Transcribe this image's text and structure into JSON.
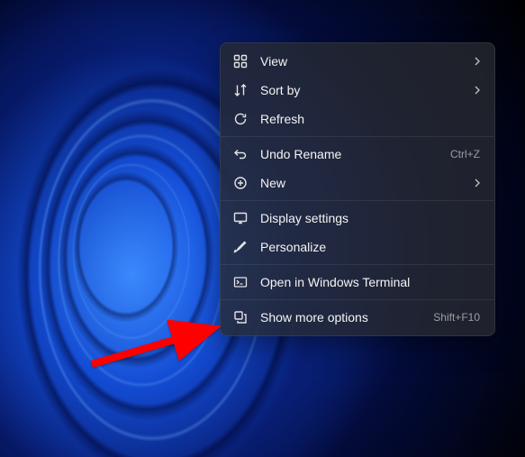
{
  "menu": {
    "view": {
      "label": "View",
      "has_submenu": true
    },
    "sort": {
      "label": "Sort by",
      "has_submenu": true
    },
    "refresh": {
      "label": "Refresh"
    },
    "undo": {
      "label": "Undo Rename",
      "shortcut": "Ctrl+Z"
    },
    "new": {
      "label": "New",
      "has_submenu": true
    },
    "display": {
      "label": "Display settings"
    },
    "personalize": {
      "label": "Personalize"
    },
    "terminal": {
      "label": "Open in Windows Terminal"
    },
    "more": {
      "label": "Show more options",
      "shortcut": "Shift+F10"
    }
  },
  "annotation": {
    "arrow_color": "#ff0000"
  }
}
